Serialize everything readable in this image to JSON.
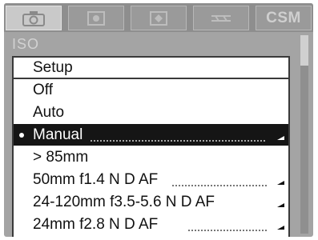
{
  "tabs": [
    {
      "icon": "camera-icon",
      "label": "",
      "active": true
    },
    {
      "icon": "tone-icon",
      "label": "",
      "active": false
    },
    {
      "icon": "adjust-icon",
      "label": "",
      "active": false
    },
    {
      "icon": "scene-icon",
      "label": "",
      "active": false
    },
    {
      "icon": "",
      "label": "CSM",
      "active": false
    }
  ],
  "section_label": "ISO",
  "menu": {
    "title": "Setup",
    "items": [
      {
        "label": "Off",
        "selected": false,
        "has_submenu": false
      },
      {
        "label": "Auto",
        "selected": false,
        "has_submenu": false
      },
      {
        "label": "Manual",
        "selected": true,
        "has_submenu": true
      },
      {
        "label": "> 85mm",
        "selected": false,
        "has_submenu": false
      },
      {
        "label": "50mm f1.4 N D AF",
        "selected": false,
        "has_submenu": true
      },
      {
        "label": "24-120mm f3.5-5.6 N D AF",
        "selected": false,
        "has_submenu": true
      },
      {
        "label": "24mm f2.8 N D AF",
        "selected": false,
        "has_submenu": true
      }
    ]
  },
  "colors": {
    "menu_background": "#ffffff",
    "selection": "#151515",
    "panel": "#a4a4a4"
  }
}
